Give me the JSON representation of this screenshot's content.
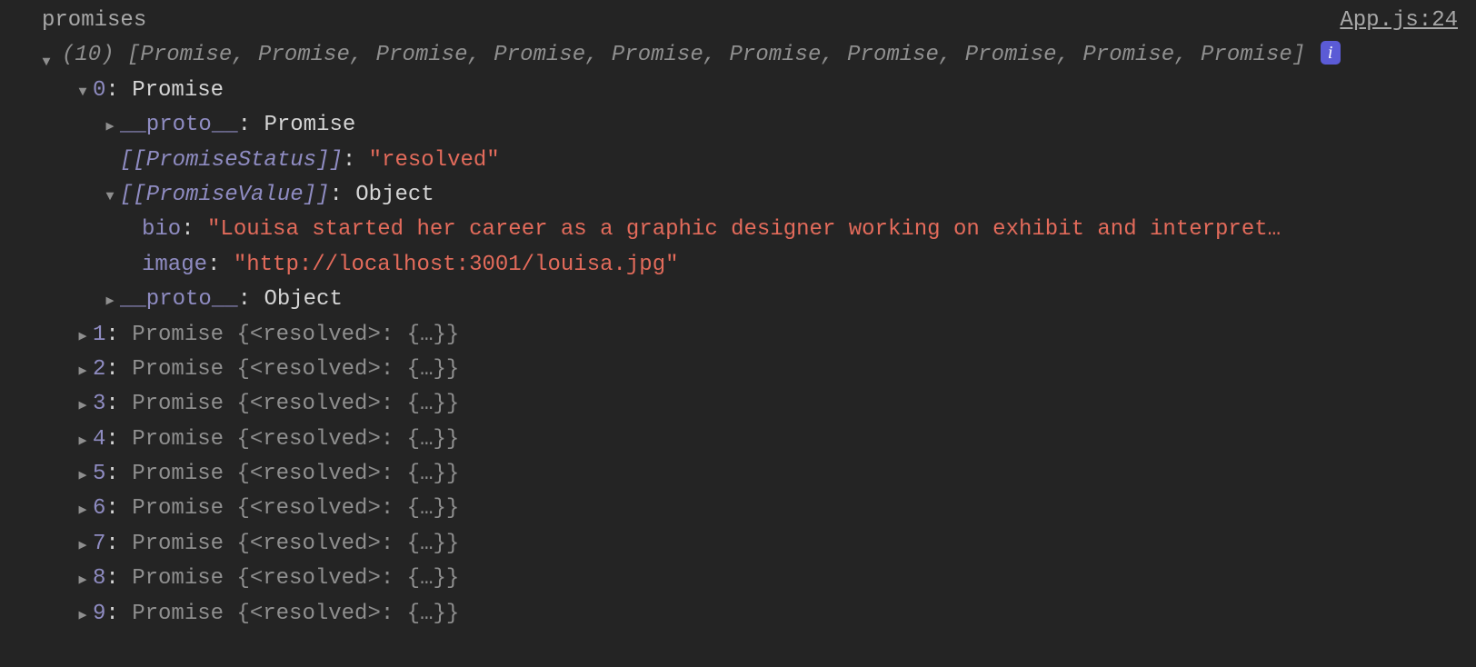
{
  "header": {
    "label": "promises",
    "sourceLink": "App.js:24"
  },
  "summary": {
    "count": "(10)",
    "text": "[Promise, Promise, Promise, Promise, Promise, Promise, Promise, Promise, Promise, Promise]",
    "info": "i"
  },
  "expanded": {
    "indexLabel": "0",
    "typeLabel": "Promise",
    "proto1": {
      "key": "__proto__",
      "value": "Promise"
    },
    "status": {
      "key": "[[PromiseStatus]]",
      "value": "\"resolved\""
    },
    "valueHeader": {
      "key": "[[PromiseValue]]",
      "value": "Object"
    },
    "bio": {
      "key": "bio",
      "value": "\"Louisa started her career as a graphic designer working on exhibit and interpret…"
    },
    "image": {
      "key": "image",
      "value": "\"http://localhost:3001/louisa.jpg\""
    },
    "proto2": {
      "key": "__proto__",
      "value": "Object"
    }
  },
  "collapsed": [
    {
      "idx": "1",
      "preview": "Promise {<resolved>: {…}}"
    },
    {
      "idx": "2",
      "preview": "Promise {<resolved>: {…}}"
    },
    {
      "idx": "3",
      "preview": "Promise {<resolved>: {…}}"
    },
    {
      "idx": "4",
      "preview": "Promise {<resolved>: {…}}"
    },
    {
      "idx": "5",
      "preview": "Promise {<resolved>: {…}}"
    },
    {
      "idx": "6",
      "preview": "Promise {<resolved>: {…}}"
    },
    {
      "idx": "7",
      "preview": "Promise {<resolved>: {…}}"
    },
    {
      "idx": "8",
      "preview": "Promise {<resolved>: {…}}"
    },
    {
      "idx": "9",
      "preview": "Promise {<resolved>: {…}}"
    }
  ]
}
